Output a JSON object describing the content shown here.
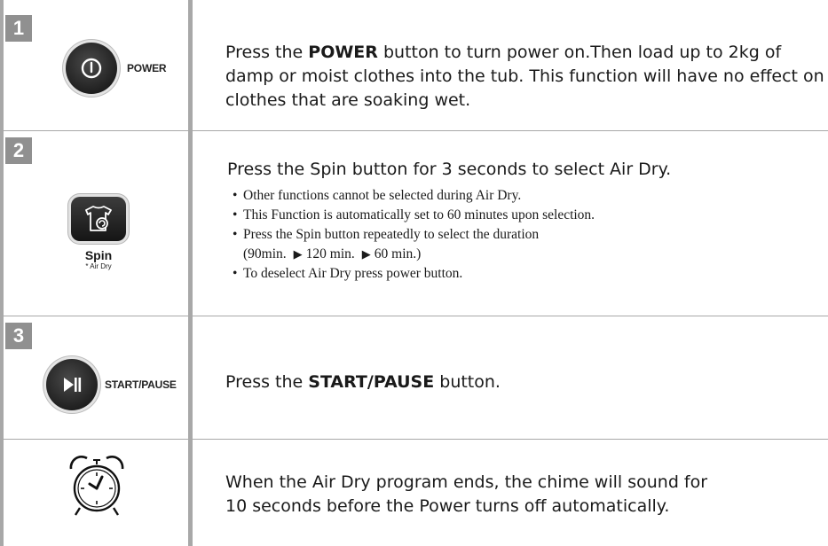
{
  "steps": [
    {
      "number": "1",
      "button_label": "POWER",
      "text_pre": "Press the ",
      "text_bold": "POWER",
      "text_line1_post": " button to turn power on.Then load up to 2kg of",
      "text_line2": "damp or moist clothes into the tub. This function will have no effect on",
      "text_line3": "clothes that are soaking wet."
    },
    {
      "number": "2",
      "button_label": "Spin",
      "button_sublabel": "* Air Dry",
      "heading": "Press the Spin button for 3 seconds to select Air Dry.",
      "bullets": [
        "Other functions cannot be selected during Air Dry.",
        "This Function is automatically set to 60 minutes upon selection.",
        "Press the Spin button repeatedly to select the duration"
      ],
      "duration_seq": [
        "(90min.",
        "120 min.",
        "60 min.)"
      ],
      "bullet_last": "To deselect Air Dry press power button."
    },
    {
      "number": "3",
      "button_label": "START/PAUSE",
      "text_pre": "Press the ",
      "text_bold": "START/PAUSE",
      "text_post": " button."
    },
    {
      "icon": "alarm-clock-icon",
      "text_line1": "When the Air Dry program ends, the chime will sound for",
      "text_line2": "10 seconds before the Power turns off automatically."
    }
  ],
  "colors": {
    "rule": "#a8a8a8",
    "badge": "#909090",
    "button": "#262626"
  },
  "icons": {
    "power": "power-icon",
    "spin": "spin-air-dry-icon",
    "play_pause": "play-pause-icon",
    "bullet_arrow": "play-arrow-icon"
  }
}
